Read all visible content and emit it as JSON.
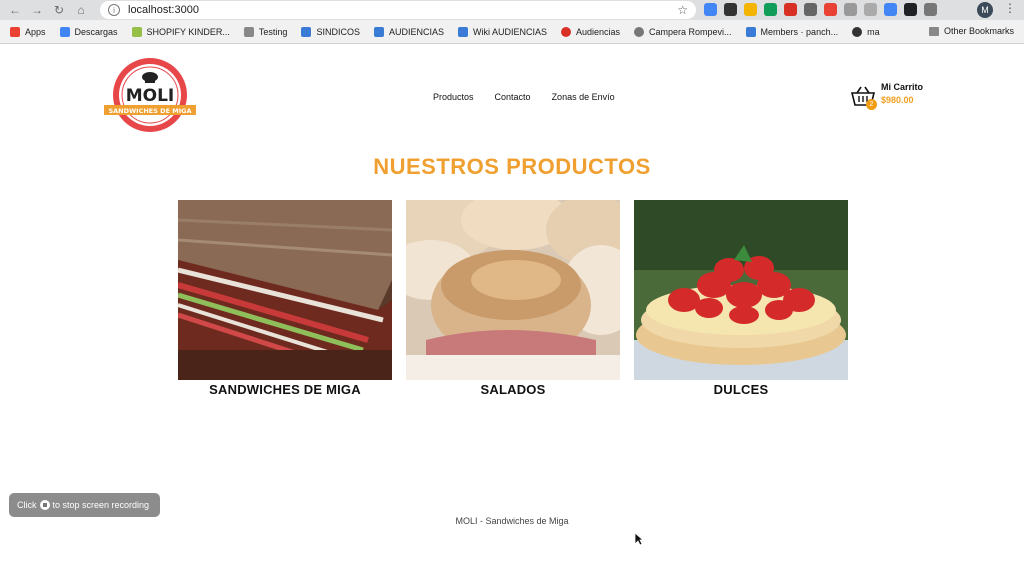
{
  "browser": {
    "url": "localhost:3000",
    "profile_initial": "M",
    "bookmarks": [
      {
        "label": "Apps",
        "color": "#e94235"
      },
      {
        "label": "Descargas",
        "color": "#4285f4"
      },
      {
        "label": "SHOPIFY KINDER...",
        "color": "#95bf47"
      },
      {
        "label": "Testing",
        "color": "#888888"
      },
      {
        "label": "SINDICOS",
        "color": "#3a7bd5"
      },
      {
        "label": "AUDIENCIAS",
        "color": "#3a7bd5"
      },
      {
        "label": "Wiki AUDIENCIAS",
        "color": "#3a7bd5"
      },
      {
        "label": "Audiencias",
        "color": "#d93025"
      },
      {
        "label": "Campera Rompevi...",
        "color": "#777777"
      },
      {
        "label": "Members · panch...",
        "color": "#3a7bd5"
      },
      {
        "label": "ma",
        "color": "#333333"
      }
    ],
    "other_bookmarks": "Other Bookmarks"
  },
  "header": {
    "logo_text": "MOLI",
    "logo_subtitle": "SANDWICHES DE MIGA",
    "nav": [
      "Productos",
      "Contacto",
      "Zonas de Envío"
    ],
    "cart_title": "Mi Carrito",
    "cart_price": "$980.00",
    "cart_count": "2"
  },
  "main": {
    "title": "NUESTROS PRODUCTOS",
    "products": [
      {
        "label": "SANDWICHES DE MIGA",
        "image": "layered-sandwich-photo"
      },
      {
        "label": "SALADOS",
        "image": "ham-rolls-photo"
      },
      {
        "label": "DULCES",
        "image": "strawberry-tart-photo"
      }
    ]
  },
  "overlay": {
    "rec_before": "Click",
    "rec_after": "to stop screen recording"
  },
  "footer": {
    "text": "MOLI - Sandwiches de Miga"
  },
  "colors": {
    "accent": "#f0a030",
    "logo_red": "#e8474a"
  }
}
